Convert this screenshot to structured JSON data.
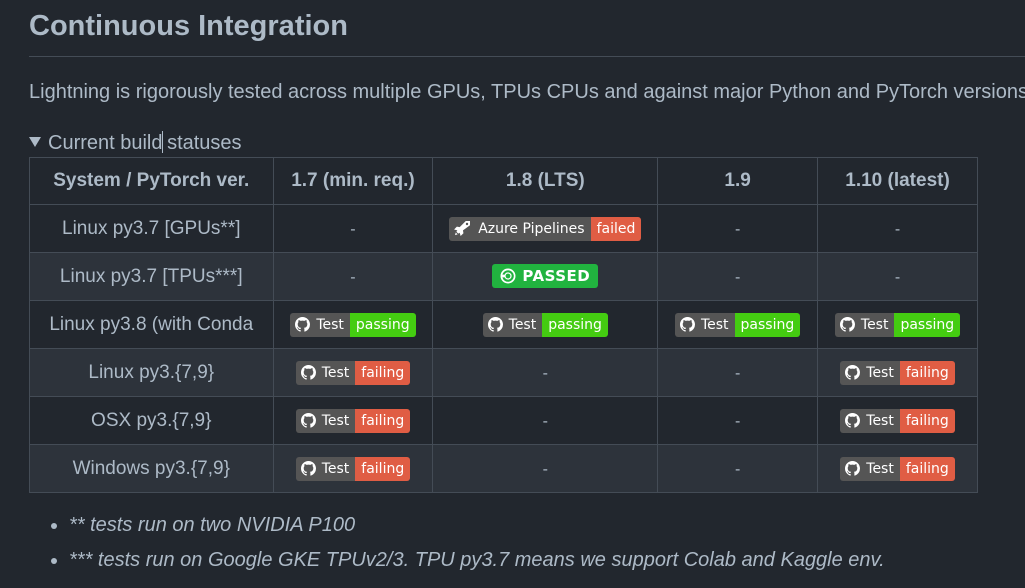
{
  "heading": "Continuous Integration",
  "intro": "Lightning is rigorously tested across multiple GPUs, TPUs CPUs and against major Python and PyTorch versions.",
  "details_summary": {
    "before_caret": "Current build",
    "after_caret": " statuses"
  },
  "table": {
    "headers": [
      "System / PyTorch ver.",
      "1.7 (min. req.)",
      "1.8 (LTS)",
      "1.9",
      "1.10 (latest)"
    ],
    "rows": [
      {
        "system": "Linux py3.7 [GPUs**]",
        "cells": [
          {
            "kind": "dash",
            "text": "-"
          },
          {
            "kind": "azure",
            "label": "Azure Pipelines",
            "status": "failed"
          },
          {
            "kind": "dash",
            "text": "-"
          },
          {
            "kind": "dash",
            "text": "-"
          }
        ]
      },
      {
        "system": "Linux py3.7 [TPUs***]",
        "cells": [
          {
            "kind": "dash",
            "text": "-"
          },
          {
            "kind": "circleci",
            "status": "PASSED"
          },
          {
            "kind": "dash",
            "text": "-"
          },
          {
            "kind": "dash",
            "text": "-"
          }
        ]
      },
      {
        "system": "Linux py3.8 (with Conda",
        "cells": [
          {
            "kind": "gh",
            "label": "Test",
            "status": "passing"
          },
          {
            "kind": "gh",
            "label": "Test",
            "status": "passing"
          },
          {
            "kind": "gh",
            "label": "Test",
            "status": "passing"
          },
          {
            "kind": "gh",
            "label": "Test",
            "status": "passing"
          }
        ]
      },
      {
        "system": "Linux py3.{7,9}",
        "cells": [
          {
            "kind": "gh",
            "label": "Test",
            "status": "failing"
          },
          {
            "kind": "dash",
            "text": "-"
          },
          {
            "kind": "dash",
            "text": "-"
          },
          {
            "kind": "gh",
            "label": "Test",
            "status": "failing"
          }
        ]
      },
      {
        "system": "OSX py3.{7,9}",
        "cells": [
          {
            "kind": "gh",
            "label": "Test",
            "status": "failing"
          },
          {
            "kind": "dash",
            "text": "-"
          },
          {
            "kind": "dash",
            "text": "-"
          },
          {
            "kind": "gh",
            "label": "Test",
            "status": "failing"
          }
        ]
      },
      {
        "system": "Windows py3.{7,9}",
        "cells": [
          {
            "kind": "gh",
            "label": "Test",
            "status": "failing"
          },
          {
            "kind": "dash",
            "text": "-"
          },
          {
            "kind": "dash",
            "text": "-"
          },
          {
            "kind": "gh",
            "label": "Test",
            "status": "failing"
          }
        ]
      }
    ]
  },
  "notes": [
    "** tests run on two NVIDIA P100",
    "*** tests run on Google GKE TPUv2/3. TPU py3.7 means we support Colab and Kaggle env."
  ],
  "colors": {
    "bg": "#22272e",
    "text": "#adbac7",
    "pass": "#44cc11",
    "fail": "#e05d44",
    "circleci": "#21b33f",
    "badge_label": "#555555"
  },
  "icons": {
    "gh": "github-icon",
    "azure": "azure-pipelines-icon",
    "circleci": "circleci-icon"
  }
}
